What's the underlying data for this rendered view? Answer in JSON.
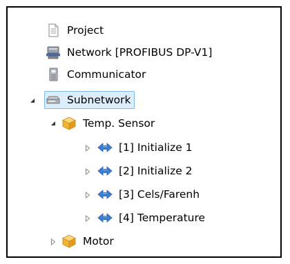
{
  "tree": {
    "items": [
      {
        "label": "Project",
        "icon": "document-icon",
        "expanded": null
      },
      {
        "label": "Network [PROFIBUS DP-V1]",
        "icon": "network-icon",
        "expanded": null
      },
      {
        "label": "Communicator",
        "icon": "communicator-icon",
        "expanded": null
      },
      {
        "label": "Subnetwork",
        "icon": "subnetwork-icon",
        "expanded": true,
        "selected": true
      },
      {
        "label": "Temp. Sensor",
        "icon": "device-box-icon",
        "expanded": true
      },
      {
        "label": "[1] Initialize 1",
        "icon": "exchange-arrows-icon",
        "expanded": false
      },
      {
        "label": "[2] Initialize 2",
        "icon": "exchange-arrows-icon",
        "expanded": false
      },
      {
        "label": "[3] Cels/Farenh",
        "icon": "exchange-arrows-icon",
        "expanded": false
      },
      {
        "label": "[4] Temperature",
        "icon": "exchange-arrows-icon",
        "expanded": false
      },
      {
        "label": "Motor",
        "icon": "device-box-icon",
        "expanded": false
      }
    ]
  },
  "colors": {
    "selection_fill": "#dceefc",
    "selection_border": "#7cb8ea",
    "arrow_blue": "#3d7fd6",
    "box_orange": "#f2b431"
  }
}
